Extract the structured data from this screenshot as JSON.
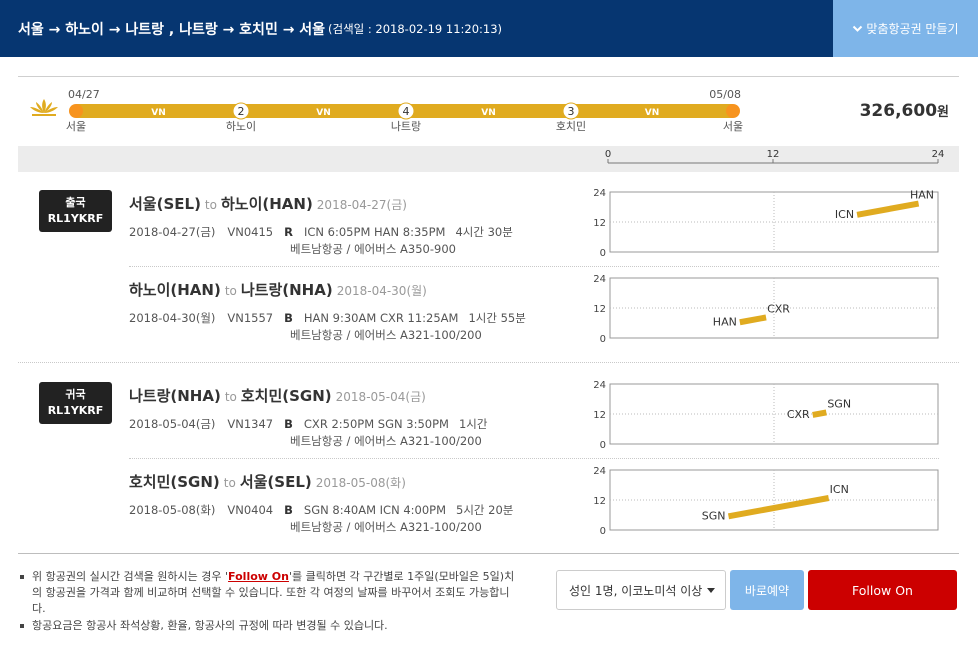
{
  "header": {
    "route_title": "서울 → 하노이 → 나트랑 , 나트랑 → 호치민 → 서울",
    "search_date": "(검색일 : 2018-02-19 11:20:13)",
    "custom_ticket_button": "맞춤항공권 만들기"
  },
  "summary": {
    "start_date": "04/27",
    "end_date": "05/08",
    "stops": [
      {
        "label": "서울",
        "marker": ""
      },
      {
        "label": "하노이",
        "marker": "2"
      },
      {
        "label": "나트랑",
        "marker": "4"
      },
      {
        "label": "호치민",
        "marker": "3"
      },
      {
        "label": "서울",
        "marker": ""
      }
    ],
    "airline_codes": [
      "VN",
      "VN",
      "VN",
      "VN"
    ],
    "price": "326,600",
    "price_unit": "원",
    "colors": {
      "route": "#e0ab20",
      "endpoint": "#f7931e"
    }
  },
  "time_scale": {
    "ticks": [
      "0",
      "12",
      "24"
    ]
  },
  "journeys": [
    {
      "badge_type": "출국",
      "badge_code": "RL1YKRF",
      "segments": [
        {
          "from": "서울(SEL)",
          "to_word": "to",
          "to": "하노이(HAN)",
          "date_label": "2018-04-27(금)",
          "date": "2018-04-27(금)",
          "flight": "VN0415",
          "class": "R",
          "times": "ICN 6:05PM HAN 8:35PM",
          "duration": "4시간 30분",
          "carrier": "베트남항공 / 에어버스 A350-900",
          "chart": {
            "dep_code": "ICN",
            "arr_code": "HAN",
            "dep_hour": 18.08,
            "arr_hour": 22.58
          }
        },
        {
          "from": "하노이(HAN)",
          "to_word": "to",
          "to": "나트랑(NHA)",
          "date_label": "2018-04-30(월)",
          "date": "2018-04-30(월)",
          "flight": "VN1557",
          "class": "B",
          "times": "HAN 9:30AM CXR 11:25AM",
          "duration": "1시간 55분",
          "carrier": "베트남항공 / 에어버스 A321-100/200",
          "chart": {
            "dep_code": "HAN",
            "arr_code": "CXR",
            "dep_hour": 9.5,
            "arr_hour": 11.42
          }
        }
      ]
    },
    {
      "badge_type": "귀국",
      "badge_code": "RL1YKRF",
      "segments": [
        {
          "from": "나트랑(NHA)",
          "to_word": "to",
          "to": "호치민(SGN)",
          "date_label": "2018-05-04(금)",
          "date": "2018-05-04(금)",
          "flight": "VN1347",
          "class": "B",
          "times": "CXR 2:50PM SGN 3:50PM",
          "duration": "1시간",
          "carrier": "베트남항공 / 에어버스 A321-100/200",
          "chart": {
            "dep_code": "CXR",
            "arr_code": "SGN",
            "dep_hour": 14.83,
            "arr_hour": 15.83
          }
        },
        {
          "from": "호치민(SGN)",
          "to_word": "to",
          "to": "서울(SEL)",
          "date_label": "2018-05-08(화)",
          "date": "2018-05-08(화)",
          "flight": "VN0404",
          "class": "B",
          "times": "SGN 8:40AM ICN 4:00PM",
          "duration": "5시간 20분",
          "carrier": "베트남항공 / 에어버스 A321-100/200",
          "chart": {
            "dep_code": "SGN",
            "arr_code": "ICN",
            "dep_hour": 8.67,
            "arr_hour": 16.0
          }
        }
      ]
    }
  ],
  "chart_axis": {
    "ticks": [
      "24",
      "12",
      "0"
    ]
  },
  "notes": {
    "line1_pre": "위 항공권의 실시간 검색을 원하시는 경우 '",
    "line1_link": "Follow On",
    "line1_post": "'를 클릭하면 각 구간별로 1주일(모바일은 5일)치의 항공권을 가격과 함께 비교하며 선택할 수 있습니다. 또한 각 여정의 날짜를 바꾸어서 조회도 가능합니다.",
    "line2": "항공요금은 항공사 좌석상황, 환율, 항공사의 규정에 따라 변경될 수 있습니다."
  },
  "actions": {
    "passenger_select": "성인 1명, 이코노미석 이상",
    "book_now": "바로예약",
    "follow_on": "Follow On"
  }
}
